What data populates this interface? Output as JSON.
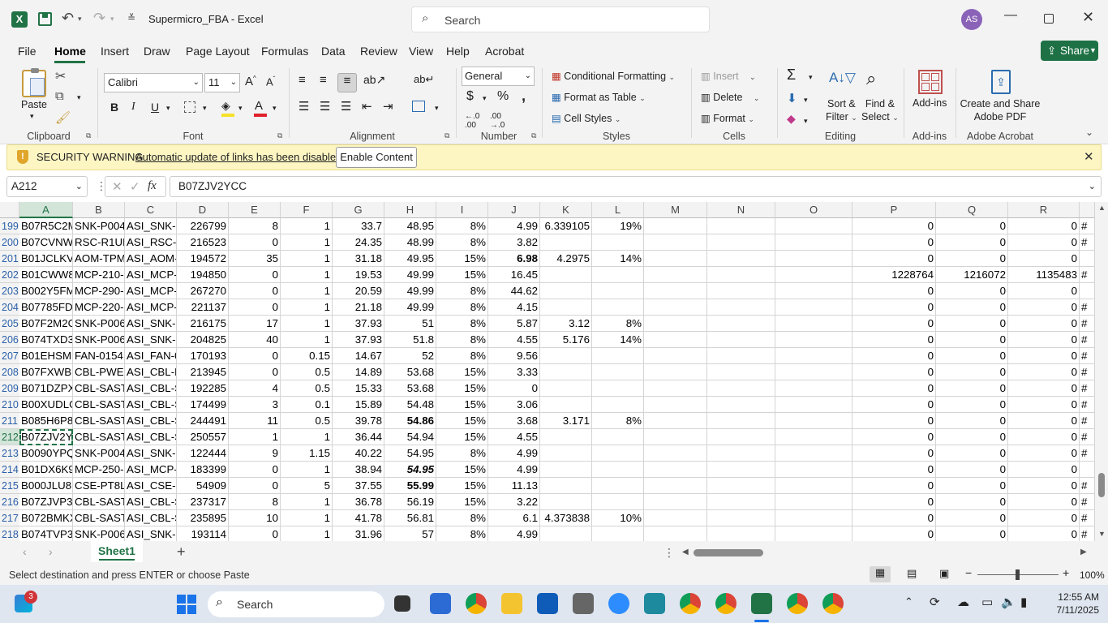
{
  "window": {
    "title": "Supermicro_FBA  -  Excel",
    "search_placeholder": "Search",
    "user_initials": "AS"
  },
  "menu": {
    "tabs": [
      "File",
      "Home",
      "Insert",
      "Draw",
      "Page Layout",
      "Formulas",
      "Data",
      "Review",
      "View",
      "Help",
      "Acrobat"
    ],
    "active": "Home",
    "share_label": "Share"
  },
  "ribbon": {
    "clipboard": {
      "paste": "Paste",
      "label": "Clipboard"
    },
    "font": {
      "name": "Calibri",
      "size": "11",
      "label": "Font"
    },
    "alignment": {
      "label": "Alignment"
    },
    "number": {
      "format": "General",
      "label": "Number"
    },
    "styles": {
      "conditional": "Conditional Formatting",
      "format_table": "Format as Table",
      "cell_styles": "Cell Styles",
      "label": "Styles"
    },
    "cells": {
      "insert": "Insert",
      "delete": "Delete",
      "format": "Format",
      "label": "Cells"
    },
    "editing": {
      "sort1": "Sort &",
      "sort2": "Filter",
      "find1": "Find &",
      "find2": "Select",
      "label": "Editing"
    },
    "addins": {
      "btn": "Add-ins",
      "label": "Add-ins"
    },
    "acrobat": {
      "btn1": "Create and Share",
      "btn2": "Adobe PDF",
      "label": "Adobe Acrobat"
    }
  },
  "security": {
    "title": "SECURITY WARNING",
    "message": "Automatic update of links has been disabled",
    "button": "Enable Content"
  },
  "formula_bar": {
    "name_box": "A212",
    "fx": "fx",
    "content": "B07ZJV2YCC"
  },
  "grid": {
    "columns": [
      "A",
      "B",
      "C",
      "D",
      "E",
      "F",
      "G",
      "H",
      "I",
      "J",
      "K",
      "L",
      "M",
      "N",
      "O",
      "P",
      "Q",
      "R"
    ],
    "rows": [
      {
        "n": "199",
        "A": "B07R5C2M",
        "B": "SNK-P004",
        "C": "ASI_SNK-F",
        "D": "226799",
        "E": "8",
        "F": "1",
        "G": "33.7",
        "H": "48.95",
        "I": "8%",
        "J": "4.99",
        "K": "6.339105",
        "L": "19%",
        "P": "0",
        "Q": "0",
        "R": "0",
        "S": "#"
      },
      {
        "n": "200",
        "A": "B07CVNW",
        "B": "RSC-R1UF",
        "C": "ASI_RSC-R",
        "D": "216523",
        "E": "0",
        "F": "1",
        "G": "24.35",
        "H": "48.99",
        "I": "8%",
        "J": "3.82",
        "K": "",
        "L": "",
        "P": "0",
        "Q": "0",
        "R": "0",
        "S": "#"
      },
      {
        "n": "201",
        "A": "B01JCLKV",
        "B": "AOM-TPM",
        "C": "ASI_AOM-",
        "D": "194572",
        "E": "35",
        "F": "1",
        "G": "31.18",
        "H": "49.95",
        "I": "15%",
        "J": "6.98",
        "Jb": true,
        "K": "4.2975",
        "L": "14%",
        "P": "0",
        "Q": "0",
        "R": "0",
        "S": ""
      },
      {
        "n": "202",
        "A": "B01CWW8",
        "B": "MCP-210-",
        "C": "ASI_MCP-",
        "D": "194850",
        "E": "0",
        "F": "1",
        "G": "19.53",
        "H": "49.99",
        "I": "15%",
        "J": "16.45",
        "K": "",
        "L": "",
        "P": "1228764",
        "Q": "1216072",
        "R": "1135483",
        "S": "#"
      },
      {
        "n": "203",
        "A": "B002Y5FM",
        "B": "MCP-290-",
        "C": "ASI_MCP-",
        "D": "267270",
        "E": "0",
        "F": "1",
        "G": "20.59",
        "H": "49.99",
        "I": "8%",
        "J": "44.62",
        "K": "",
        "L": "",
        "P": "0",
        "Q": "0",
        "R": "0",
        "S": ""
      },
      {
        "n": "204",
        "A": "B07785FD",
        "B": "MCP-220-",
        "C": "ASI_MCP-",
        "D": "221137",
        "E": "0",
        "F": "1",
        "G": "21.18",
        "H": "49.99",
        "I": "8%",
        "J": "4.15",
        "K": "",
        "L": "",
        "P": "0",
        "Q": "0",
        "R": "0",
        "S": "#"
      },
      {
        "n": "205",
        "A": "B07F2M2C",
        "B": "SNK-P006",
        "C": "ASI_SNK-F",
        "D": "216175",
        "E": "17",
        "F": "1",
        "G": "37.93",
        "H": "51",
        "I": "8%",
        "J": "5.87",
        "K": "3.12",
        "L": "8%",
        "P": "0",
        "Q": "0",
        "R": "0",
        "S": "#"
      },
      {
        "n": "206",
        "A": "B074TXD3",
        "B": "SNK-P006",
        "C": "ASI_SNK-F",
        "D": "204825",
        "E": "40",
        "F": "1",
        "G": "37.93",
        "H": "51.8",
        "I": "8%",
        "J": "4.55",
        "K": "5.176",
        "L": "14%",
        "P": "0",
        "Q": "0",
        "R": "0",
        "S": "#"
      },
      {
        "n": "207",
        "A": "B01EHSMI",
        "B": "FAN-0154",
        "C": "ASI_FAN-0",
        "D": "170193",
        "E": "0",
        "F": "0.15",
        "G": "14.67",
        "H": "52",
        "I": "8%",
        "J": "9.56",
        "K": "",
        "L": "",
        "P": "0",
        "Q": "0",
        "R": "0",
        "S": "#"
      },
      {
        "n": "208",
        "A": "B07FXWB",
        "B": "CBL-PWEX",
        "C": "ASI_CBL-P",
        "D": "213945",
        "E": "0",
        "F": "0.5",
        "G": "14.89",
        "H": "53.68",
        "I": "15%",
        "J": "3.33",
        "K": "",
        "L": "",
        "P": "0",
        "Q": "0",
        "R": "0",
        "S": "#"
      },
      {
        "n": "209",
        "A": "B071DZPX",
        "B": "CBL-SAST-",
        "C": "ASI_CBL-S",
        "D": "192285",
        "E": "4",
        "F": "0.5",
        "G": "15.33",
        "H": "53.68",
        "I": "15%",
        "J": "0",
        "K": "",
        "L": "",
        "P": "0",
        "Q": "0",
        "R": "0",
        "S": "#"
      },
      {
        "n": "210",
        "A": "B00XUDLG",
        "B": "CBL-SAST-",
        "C": "ASI_CBL-S",
        "D": "174499",
        "E": "3",
        "F": "0.1",
        "G": "15.89",
        "H": "54.48",
        "I": "15%",
        "J": "3.06",
        "K": "",
        "L": "",
        "P": "0",
        "Q": "0",
        "R": "0",
        "S": "#"
      },
      {
        "n": "211",
        "A": "B085H6P8",
        "B": "CBL-SAST-",
        "C": "ASI_CBL-S",
        "D": "244491",
        "E": "11",
        "F": "0.5",
        "G": "39.78",
        "H": "54.86",
        "Hb": true,
        "I": "15%",
        "J": "3.68",
        "K": "3.171",
        "L": "8%",
        "P": "0",
        "Q": "0",
        "R": "0",
        "S": "#"
      },
      {
        "n": "212",
        "A": "B07ZJV2YC",
        "B": "CBL-SAST-",
        "C": "ASI_CBL-S",
        "D": "250557",
        "E": "1",
        "F": "1",
        "G": "36.44",
        "H": "54.94",
        "I": "15%",
        "J": "4.55",
        "K": "",
        "L": "",
        "P": "0",
        "Q": "0",
        "R": "0",
        "S": "#"
      },
      {
        "n": "213",
        "A": "B0090YPQ",
        "B": "SNK-P004",
        "C": "ASI_SNK-F",
        "D": "122444",
        "E": "9",
        "F": "1.15",
        "G": "40.22",
        "H": "54.95",
        "I": "8%",
        "J": "4.99",
        "K": "",
        "L": "",
        "P": "0",
        "Q": "0",
        "R": "0",
        "S": "#"
      },
      {
        "n": "214",
        "A": "B01DX6K9",
        "B": "MCP-250-",
        "C": "ASI_MCP-",
        "D": "183399",
        "E": "0",
        "F": "1",
        "G": "38.94",
        "H": "54.95",
        "Hb": true,
        "Hi": true,
        "I": "15%",
        "J": "4.99",
        "K": "",
        "L": "",
        "P": "0",
        "Q": "0",
        "R": "0",
        "S": ""
      },
      {
        "n": "215",
        "A": "B000JLU8K",
        "B": "CSE-PT8L",
        "C": "ASI_CSE-P",
        "D": "54909",
        "E": "0",
        "F": "5",
        "G": "37.55",
        "H": "55.99",
        "Hb": true,
        "I": "15%",
        "J": "11.13",
        "K": "",
        "L": "",
        "P": "0",
        "Q": "0",
        "R": "0",
        "S": "#"
      },
      {
        "n": "216",
        "A": "B07ZJVP3",
        "B": "CBL-SAST-",
        "C": "ASI_CBL-S",
        "D": "237317",
        "E": "8",
        "F": "1",
        "G": "36.78",
        "H": "56.19",
        "I": "15%",
        "J": "3.22",
        "K": "",
        "L": "",
        "P": "0",
        "Q": "0",
        "R": "0",
        "S": "#"
      },
      {
        "n": "217",
        "A": "B072BMKX",
        "B": "CBL-SAST-",
        "C": "ASI_CBL-S",
        "D": "235895",
        "E": "10",
        "F": "1",
        "G": "41.78",
        "H": "56.81",
        "I": "8%",
        "J": "6.1",
        "K": "4.373838",
        "L": "10%",
        "P": "0",
        "Q": "0",
        "R": "0",
        "S": "#"
      },
      {
        "n": "218",
        "A": "B074TVP3",
        "B": "SNK-P006",
        "C": "ASI_SNK-F",
        "D": "193114",
        "E": "0",
        "F": "1",
        "G": "31.96",
        "H": "57",
        "I": "8%",
        "J": "4.99",
        "K": "",
        "L": "",
        "P": "0",
        "Q": "0",
        "R": "0",
        "S": "#"
      }
    ]
  },
  "sheets": {
    "tabs": [
      "Sheet1"
    ],
    "active": "Sheet1"
  },
  "status": {
    "message": "Select destination and press ENTER or choose Paste",
    "zoom": "100%"
  },
  "taskbar": {
    "search_placeholder": "Search",
    "notification_badge": "3",
    "time": "12:55 AM",
    "date": "7/11/2025"
  },
  "colors": {
    "excel_green": "#217346",
    "share_green": "#1e7145",
    "active_row": "#217346"
  }
}
